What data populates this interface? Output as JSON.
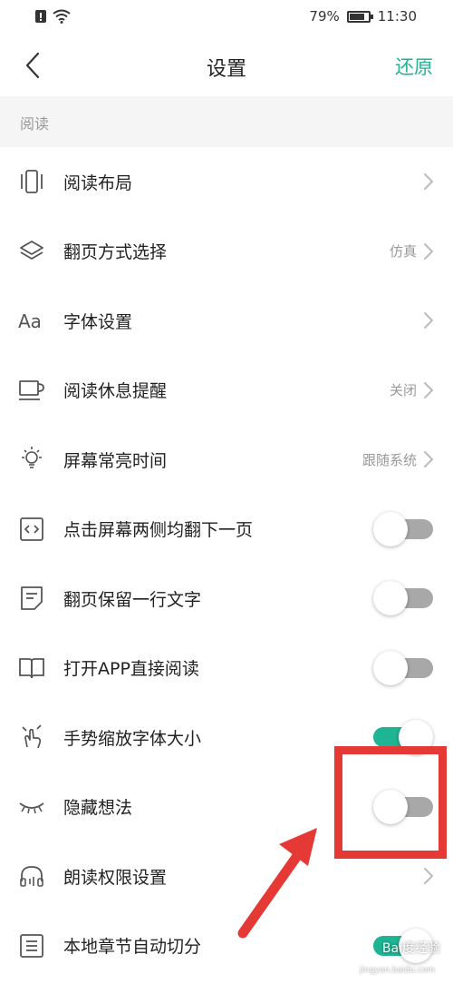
{
  "status_bar": {
    "battery_text": "79%",
    "battery_level": 0.79,
    "time": "11:30"
  },
  "nav": {
    "title": "设置",
    "restore_label": "还原",
    "accent_color": "#1fb494"
  },
  "section": {
    "title": "阅读"
  },
  "items": [
    {
      "label": "阅读布局",
      "icon": "layout-icon",
      "value": "",
      "type": "chevron"
    },
    {
      "label": "翻页方式选择",
      "icon": "layers-icon",
      "value": "仿真",
      "type": "chevron"
    },
    {
      "label": "字体设置",
      "icon": "font-icon",
      "value": "",
      "type": "chevron"
    },
    {
      "label": "阅读休息提醒",
      "icon": "cup-icon",
      "value": "关闭",
      "type": "chevron"
    },
    {
      "label": "屏幕常亮时间",
      "icon": "bulb-icon",
      "value": "跟随系统",
      "type": "chevron"
    },
    {
      "label": "点击屏幕两侧均翻下一页",
      "icon": "code-icon",
      "value": "",
      "type": "toggle",
      "on": false
    },
    {
      "label": "翻页保留一行文字",
      "icon": "note-icon",
      "value": "",
      "type": "toggle",
      "on": false
    },
    {
      "label": "打开APP直接阅读",
      "icon": "book-icon",
      "value": "",
      "type": "toggle",
      "on": false
    },
    {
      "label": "手势缩放字体大小",
      "icon": "gesture-icon",
      "value": "",
      "type": "toggle",
      "on": true
    },
    {
      "label": "隐藏想法",
      "icon": "eye-closed-icon",
      "value": "",
      "type": "toggle",
      "on": false
    },
    {
      "label": "朗读权限设置",
      "icon": "headphones-icon",
      "value": "",
      "type": "chevron"
    },
    {
      "label": "本地章节自动切分",
      "icon": "list-icon",
      "value": "",
      "type": "toggle",
      "on": true
    }
  ],
  "watermark": {
    "text": "Bai度经验",
    "sub": "jingyan.baidu.com"
  }
}
